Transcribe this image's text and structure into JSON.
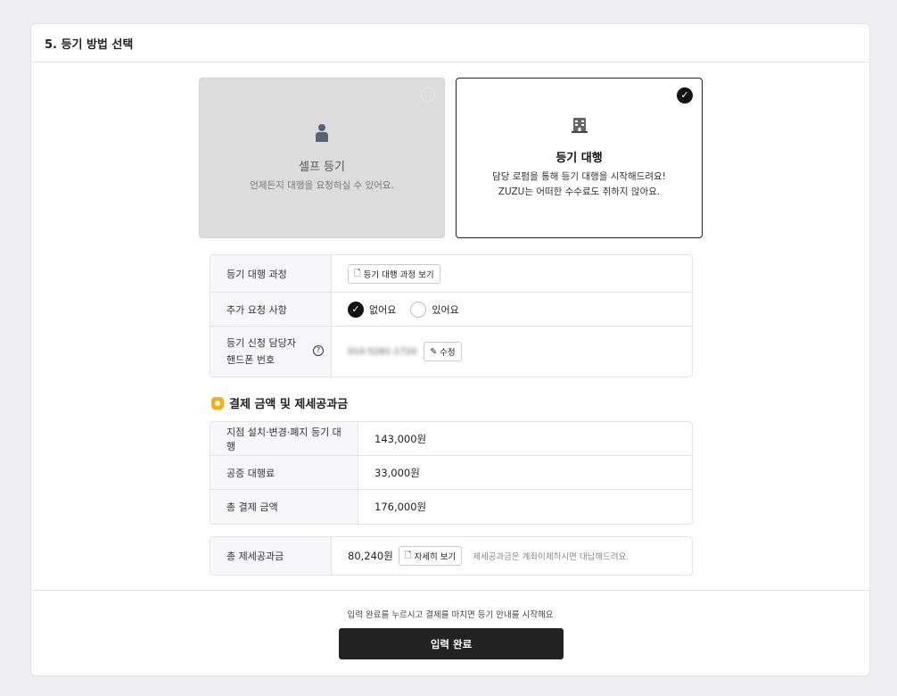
{
  "section": {
    "title": "5. 등기 방법 선택"
  },
  "options": {
    "self": {
      "title": "셀프 등기",
      "desc": "언제든지 대행을 요청하실 수 있어요."
    },
    "agent": {
      "title": "등기 대행",
      "desc1": "담당 로펌을 통해 등기 대행을 시작해드려요!",
      "desc2": "ZUZU는 어떠한 수수료도 취하지 않아요."
    }
  },
  "process_table": {
    "rows": [
      {
        "label": "등기 대행 과정",
        "button": "등기 대행 과정 보기"
      },
      {
        "label": "추가 요청 사항",
        "opt_no": "없어요",
        "opt_yes": "있어요"
      },
      {
        "label_line1": "등기 신청 담당자",
        "label_line2": "핸드폰 번호",
        "phone": "010-5281-1720",
        "button": "수정"
      }
    ]
  },
  "payment": {
    "title": "결제 금액 및 제세공과금",
    "rows": [
      {
        "label": "지점 설치·변경·폐지 등기 대행",
        "value": "143,000원"
      },
      {
        "label": "공증 대행료",
        "value": "33,000원"
      },
      {
        "label": "총 결제 금액",
        "value": "176,000원"
      }
    ]
  },
  "tax": {
    "label": "총 제세공과금",
    "value": "80,240원",
    "button": "자세히 보기",
    "note": "제세공과금은 계좌이체하시면 대납해드려요."
  },
  "footer": {
    "note": "입력 완료를 누르시고 결제를 마치면 등기 안내를 시작해요",
    "submit": "입력 완료"
  },
  "colors": {
    "accent": "#222222",
    "coin": "#f2b01e",
    "selected_border": "#222222",
    "disabled_bg": "#dcdcdc"
  }
}
